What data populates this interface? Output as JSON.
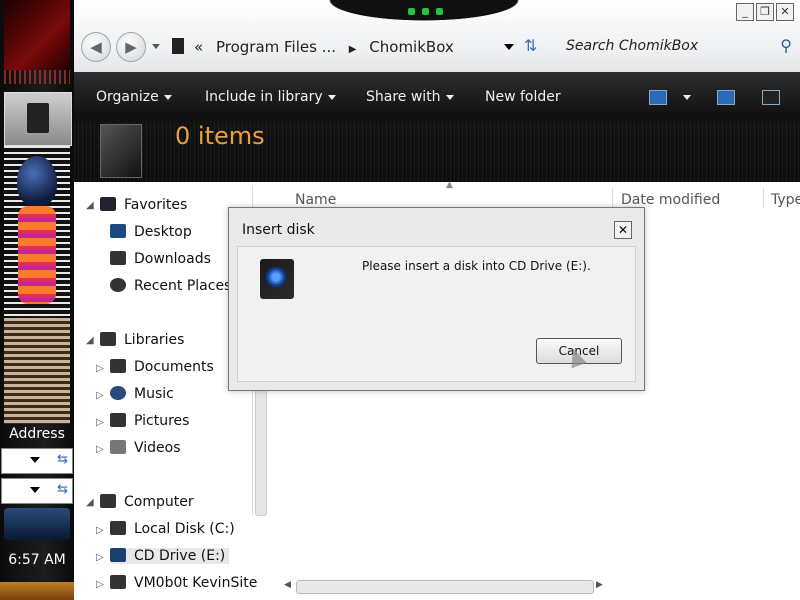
{
  "taskbar": {
    "address_label": "Address",
    "clock": "6:57 AM"
  },
  "window": {
    "controls": [
      "_",
      "❐",
      "✕"
    ],
    "breadcrumb": [
      "Program Files ...",
      "ChomikBox"
    ],
    "breadcrumb_overflow": "«",
    "search_placeholder": "Search ChomikBox",
    "toolbar": {
      "organize": "Organize",
      "include_in_library": "Include in library",
      "share_with": "Share with",
      "new_folder": "New folder"
    },
    "item_count": "0 items",
    "columns": [
      "Name",
      "Date modified",
      "Type"
    ]
  },
  "navpane": {
    "favorites": {
      "label": "Favorites",
      "items": [
        "Desktop",
        "Downloads",
        "Recent Places"
      ]
    },
    "libraries": {
      "label": "Libraries",
      "items": [
        "Documents",
        "Music",
        "Pictures",
        "Videos"
      ]
    },
    "computer": {
      "label": "Computer",
      "items": [
        "Local Disk (C:)",
        "CD Drive (E:)",
        "VM0b0t KevinSite"
      ]
    }
  },
  "dialog": {
    "title": "Insert disk",
    "message": "Please insert a disk into CD Drive (E:).",
    "cancel": "Cancel",
    "close": "✕"
  }
}
